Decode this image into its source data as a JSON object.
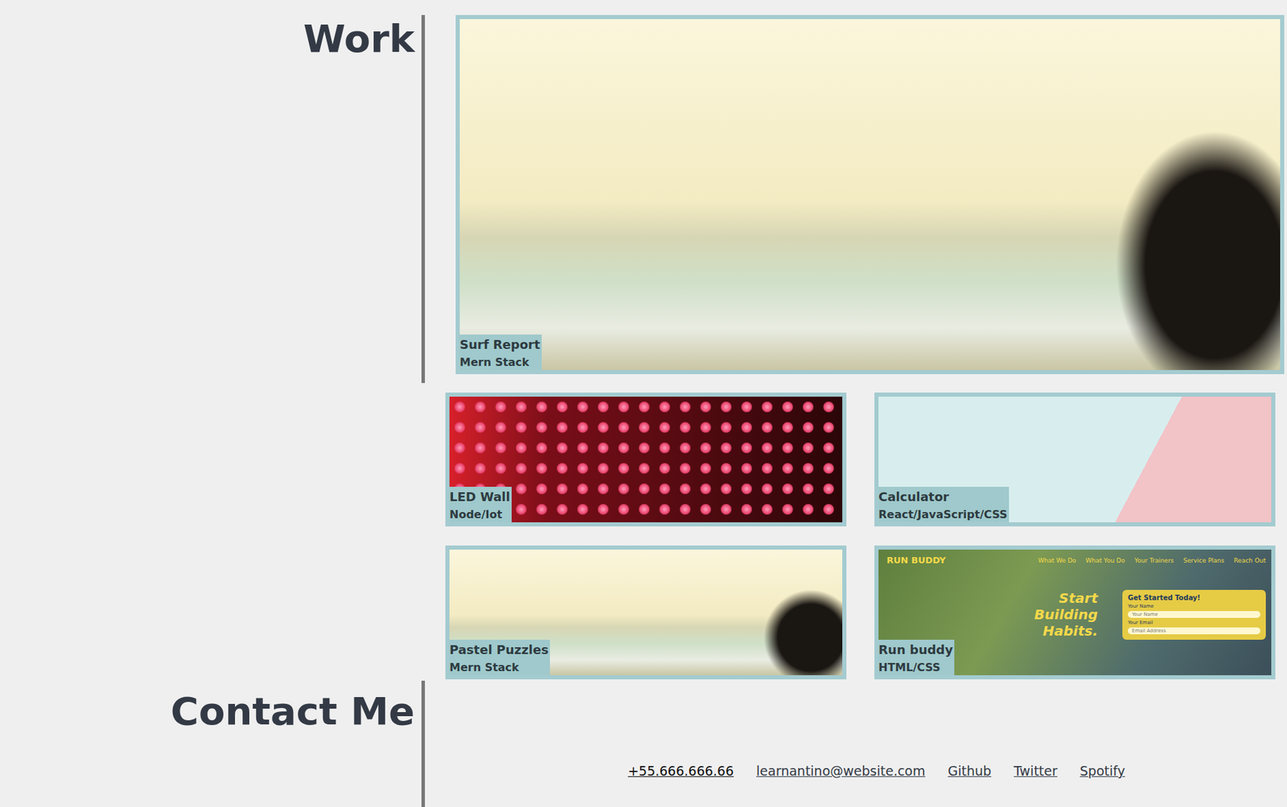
{
  "sections": {
    "work": "Work",
    "contact": "Contact Me"
  },
  "featured": {
    "title": "Surf Report",
    "stack": "Mern Stack",
    "kind": "surf"
  },
  "projects": [
    {
      "title": "LED Wall",
      "stack": "Node/Iot",
      "kind": "led"
    },
    {
      "title": "Calculator",
      "stack": "React/JavaScript/CSS",
      "kind": "calculator"
    },
    {
      "title": "Pastel Puzzles",
      "stack": "Mern Stack",
      "kind": "surf"
    },
    {
      "title": "Run buddy",
      "stack": "HTML/CSS",
      "kind": "site"
    }
  ],
  "site": {
    "brand": "RUN BUDDY",
    "nav": [
      "What We Do",
      "What You Do",
      "Your Trainers",
      "Service Plans",
      "Reach Out"
    ],
    "headline": "Start Building Habits.",
    "form": {
      "title": "Get Started Today!",
      "fields": [
        {
          "label": "Your Name",
          "placeholder": "Your Name"
        },
        {
          "label": "Your Email",
          "placeholder": "Email Address"
        }
      ]
    }
  },
  "contact": {
    "links": [
      "+55.666.666.66",
      "learnantino@website.com",
      "Github",
      "Twitter",
      "Spotify"
    ]
  }
}
